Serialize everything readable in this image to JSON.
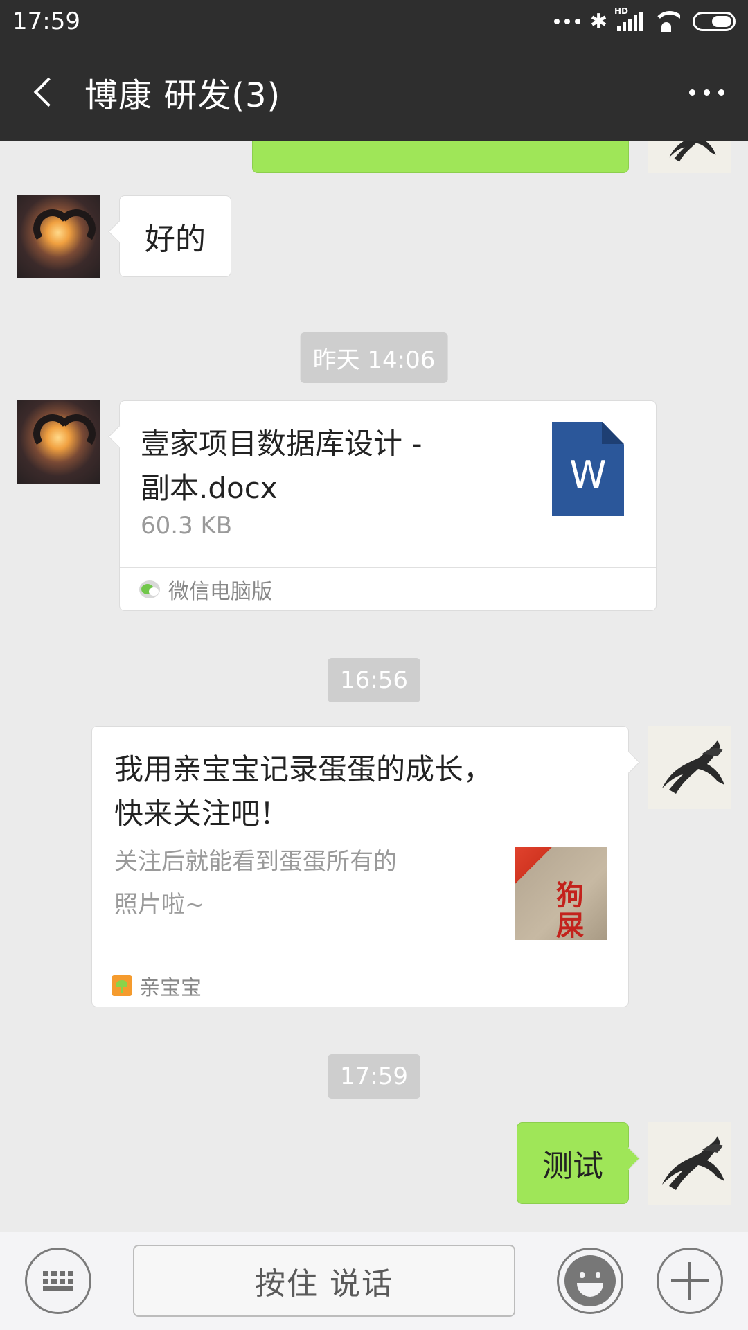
{
  "status_bar": {
    "time": "17:59",
    "signal_badge": "HD",
    "icons": [
      "more-dots-icon",
      "bluetooth-icon",
      "signal-icon",
      "wifi-icon",
      "battery-icon"
    ]
  },
  "header": {
    "title": "博康 研发(3)",
    "back_icon": "chevron-left-icon",
    "more_icon": "more-horizontal-icon"
  },
  "messages": [
    {
      "kind": "text",
      "side": "left",
      "text": "好的"
    },
    {
      "kind": "timestamp",
      "text": "昨天 14:06"
    },
    {
      "kind": "file",
      "side": "left",
      "file_name": "壹家项目数据库设计 - 副本.docx",
      "file_size": "60.3 KB",
      "file_icon": "W",
      "source": "微信电脑版"
    },
    {
      "kind": "timestamp",
      "text": "16:56"
    },
    {
      "kind": "share",
      "side": "right",
      "title": "我用亲宝宝记录蛋蛋的成长，快来关注吧！",
      "description": "关注后就能看到蛋蛋所有的照片啦~",
      "source": "亲宝宝"
    },
    {
      "kind": "timestamp",
      "text": "17:59"
    },
    {
      "kind": "text",
      "side": "right",
      "text": "测试"
    }
  ],
  "input_bar": {
    "keyboard_icon": "keyboard-icon",
    "voice_label": "按住 说话",
    "emoji_icon": "emoji-icon",
    "plus_icon": "plus-icon"
  },
  "colors": {
    "header_bg": "#2e2e2e",
    "chat_bg": "#ebebeb",
    "outgoing_bubble": "#9fe658",
    "word_blue": "#2b579a"
  }
}
